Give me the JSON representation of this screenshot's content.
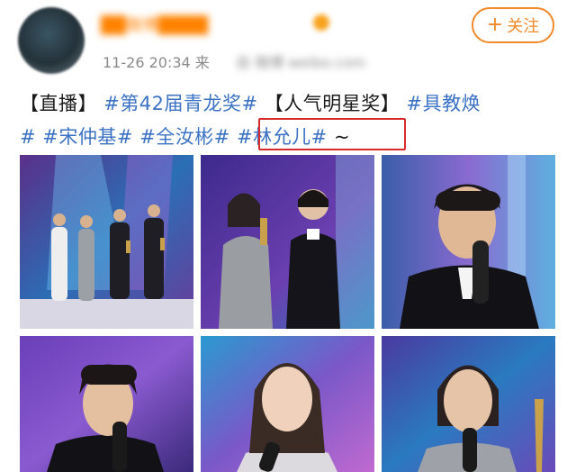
{
  "post": {
    "username": "██微博████",
    "timestamp": "11-26 20:34",
    "source_prefix": "来",
    "source_blurred": "自 微博 weibo.com",
    "follow_label": "关注",
    "follow_plus": "+",
    "text": {
      "seg1": "【直播】",
      "tag1": "#第42届青龙奖#",
      "seg2": "【人气明星奖】",
      "tag2": "#具教焕",
      "tag2b": "#",
      "tag3": "#宋仲基#",
      "tag4": "#全汝彬#",
      "tag5": "#林允儿#",
      "tail": "~"
    }
  },
  "colors": {
    "tag": "#3b72c4",
    "follow": "#f08a2a",
    "highlight": "#d72a2a",
    "meta": "#8a8a8a"
  },
  "photos": [
    {
      "name": "photo-group-stage",
      "scene": "award-winners-on-stage"
    },
    {
      "name": "photo-actress-actor-trophy",
      "scene": "two-winners-holding-trophy"
    },
    {
      "name": "photo-actor-speech",
      "scene": "actor-with-microphone"
    },
    {
      "name": "photo-song-joong-ki",
      "scene": "actor-with-microphone"
    },
    {
      "name": "photo-lim-yoona",
      "scene": "actress-with-microphone"
    },
    {
      "name": "photo-jeon-yeo-been",
      "scene": "actress-with-microphone-trophy"
    }
  ]
}
